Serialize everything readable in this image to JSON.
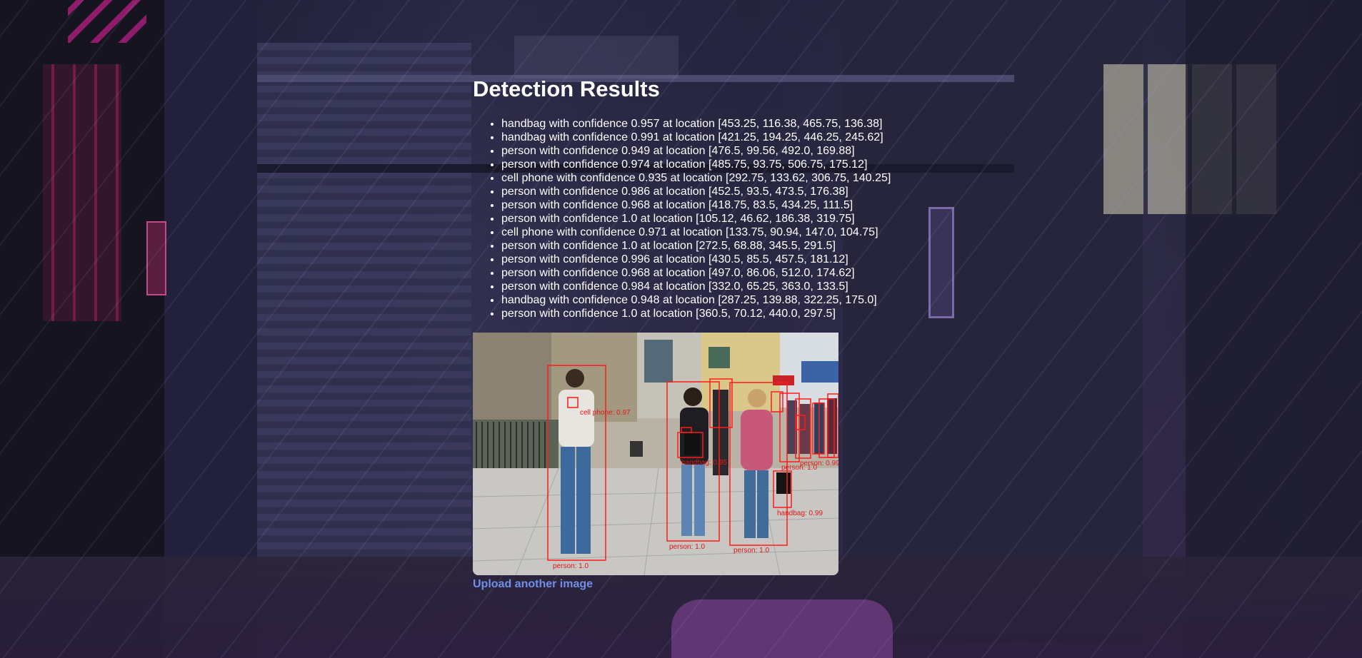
{
  "page": {
    "title": "Detection Results"
  },
  "detections": [
    "handbag with confidence 0.957 at location [453.25, 116.38, 465.75, 136.38]",
    "handbag with confidence 0.991 at location [421.25, 194.25, 446.25, 245.62]",
    "person with confidence 0.949 at location [476.5, 99.56, 492.0, 169.88]",
    "person with confidence 0.974 at location [485.75, 93.75, 506.75, 175.12]",
    "cell phone with confidence 0.935 at location [292.75, 133.62, 306.75, 140.25]",
    "person with confidence 0.986 at location [452.5, 93.5, 473.5, 176.38]",
    "person with confidence 0.968 at location [418.75, 83.5, 434.25, 111.5]",
    "person with confidence 1.0 at location [105.12, 46.62, 186.38, 319.75]",
    "cell phone with confidence 0.971 at location [133.75, 90.94, 147.0, 104.75]",
    "person with confidence 1.0 at location [272.5, 68.88, 345.5, 291.5]",
    "person with confidence 0.996 at location [430.5, 85.5, 457.5, 181.12]",
    "person with confidence 0.968 at location [497.0, 86.06, 512.0, 174.62]",
    "person with confidence 0.984 at location [332.0, 65.25, 363.0, 133.5]",
    "handbag with confidence 0.948 at location [287.25, 139.88, 322.25, 175.0]",
    "person with confidence 1.0 at location [360.5, 70.12, 440.0, 297.5]"
  ],
  "image_labels": {
    "person_left": "person: 1.0",
    "person_middle": "person: 1.0",
    "person_right": "person: 1.0",
    "handbag_right": "handbag: 0.99",
    "handbag_middle": "handbag: 0.95",
    "phone_left": "cell phone: 0.97",
    "person_back_1": "person: 1.0",
    "person_back_2": "person: 0.99"
  },
  "link": {
    "upload_label": "Upload another image"
  }
}
